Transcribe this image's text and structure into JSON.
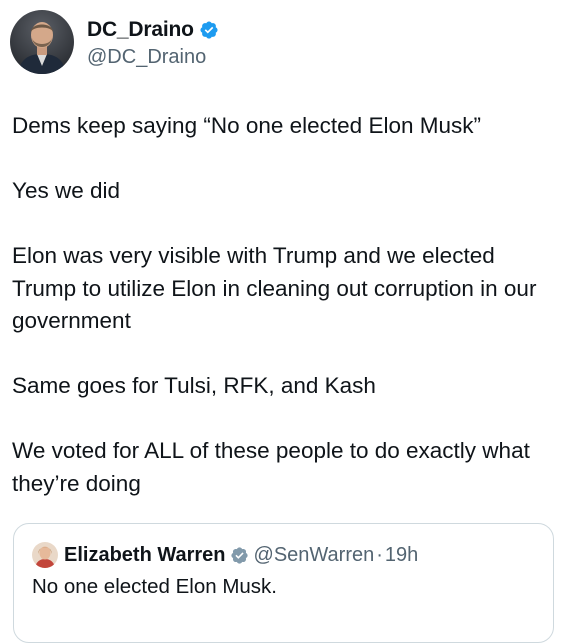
{
  "author": {
    "display_name": "DC_Draino",
    "handle": "@DC_Draino",
    "verified": true,
    "verified_color": "#1d9bf0"
  },
  "tweet": {
    "paragraphs": [
      "Dems keep saying “No one elected Elon Musk”",
      "Yes we did",
      "Elon was very visible with Trump and we elected Trump to utilize Elon in cleaning out corruption in our government",
      "Same goes for Tulsi, RFK, and Kash",
      "We voted for ALL of these people to do exactly what they’re doing"
    ]
  },
  "quoted_tweet": {
    "display_name": "Elizabeth Warren",
    "handle": "@SenWarren",
    "separator": "·",
    "time": "19h",
    "verified_badge": "gray-government-badge",
    "verified_color": "#829aab",
    "text": "No one elected Elon Musk."
  },
  "icons": {
    "author_avatar": "avatar-photo-icon",
    "author_badge": "verified-badge-icon",
    "quoted_avatar": "avatar-photo-icon",
    "quoted_badge": "verified-badge-icon"
  }
}
